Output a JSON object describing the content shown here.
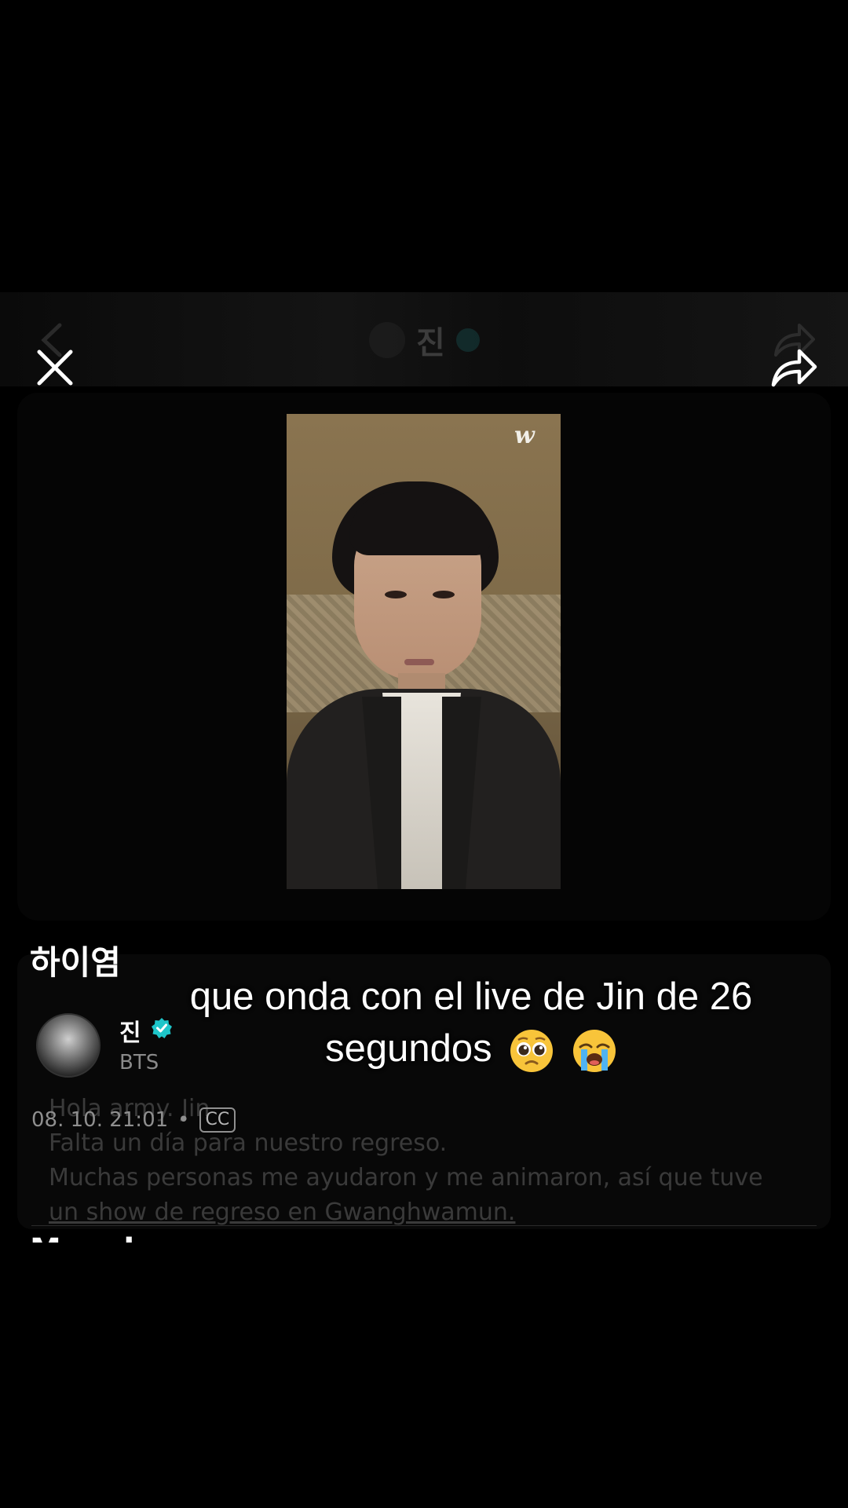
{
  "ghost_header": {
    "name": "진"
  },
  "section": {
    "title": "하이염"
  },
  "author": {
    "name": "진",
    "group": "BTS"
  },
  "post": {
    "timestamp": "08. 10. 21:01",
    "separator": "•",
    "cc": "CC",
    "ghost_lines": [
      "Hola army. Jin",
      "Falta un día para nuestro regreso.",
      "Muchas personas me ayudaron y me animaron, así que tuve",
      "un show de regreso en Gwanghwamun."
    ]
  },
  "next_section": {
    "title": "Mas da"
  },
  "video": {
    "watermark": "w"
  },
  "caption": {
    "line1": "que onda con el live de Jin de 26",
    "line2": "segundos",
    "emojis": [
      "pleading-face",
      "loudly-crying-face"
    ]
  },
  "colors": {
    "verified": "#1ec5c9",
    "background": "#000000"
  }
}
